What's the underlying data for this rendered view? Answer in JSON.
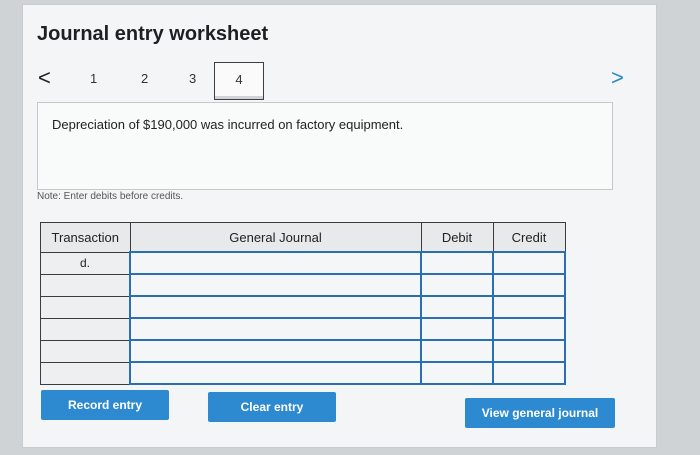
{
  "worksheet": {
    "title": "Journal entry worksheet",
    "steps": [
      "1",
      "2",
      "3",
      "4"
    ],
    "active_step": "4",
    "prev_icon": "<",
    "next_icon": ">"
  },
  "description": "Depreciation of $190,000 was incurred on factory equipment.",
  "note": "Note: Enter debits before credits.",
  "table": {
    "headers": [
      "Transaction",
      "General Journal",
      "Debit",
      "Credit"
    ],
    "rows": [
      {
        "transaction": "d.",
        "account": "",
        "debit": "",
        "credit": ""
      },
      {
        "transaction": "",
        "account": "",
        "debit": "",
        "credit": ""
      },
      {
        "transaction": "",
        "account": "",
        "debit": "",
        "credit": ""
      },
      {
        "transaction": "",
        "account": "",
        "debit": "",
        "credit": ""
      },
      {
        "transaction": "",
        "account": "",
        "debit": "",
        "credit": ""
      },
      {
        "transaction": "",
        "account": "",
        "debit": "",
        "credit": ""
      }
    ]
  },
  "buttons": {
    "record": "Record entry",
    "clear": "Clear entry",
    "view": "View general journal"
  },
  "colors": {
    "accent": "#2e8ad0",
    "input_border": "#2a6fb4"
  }
}
